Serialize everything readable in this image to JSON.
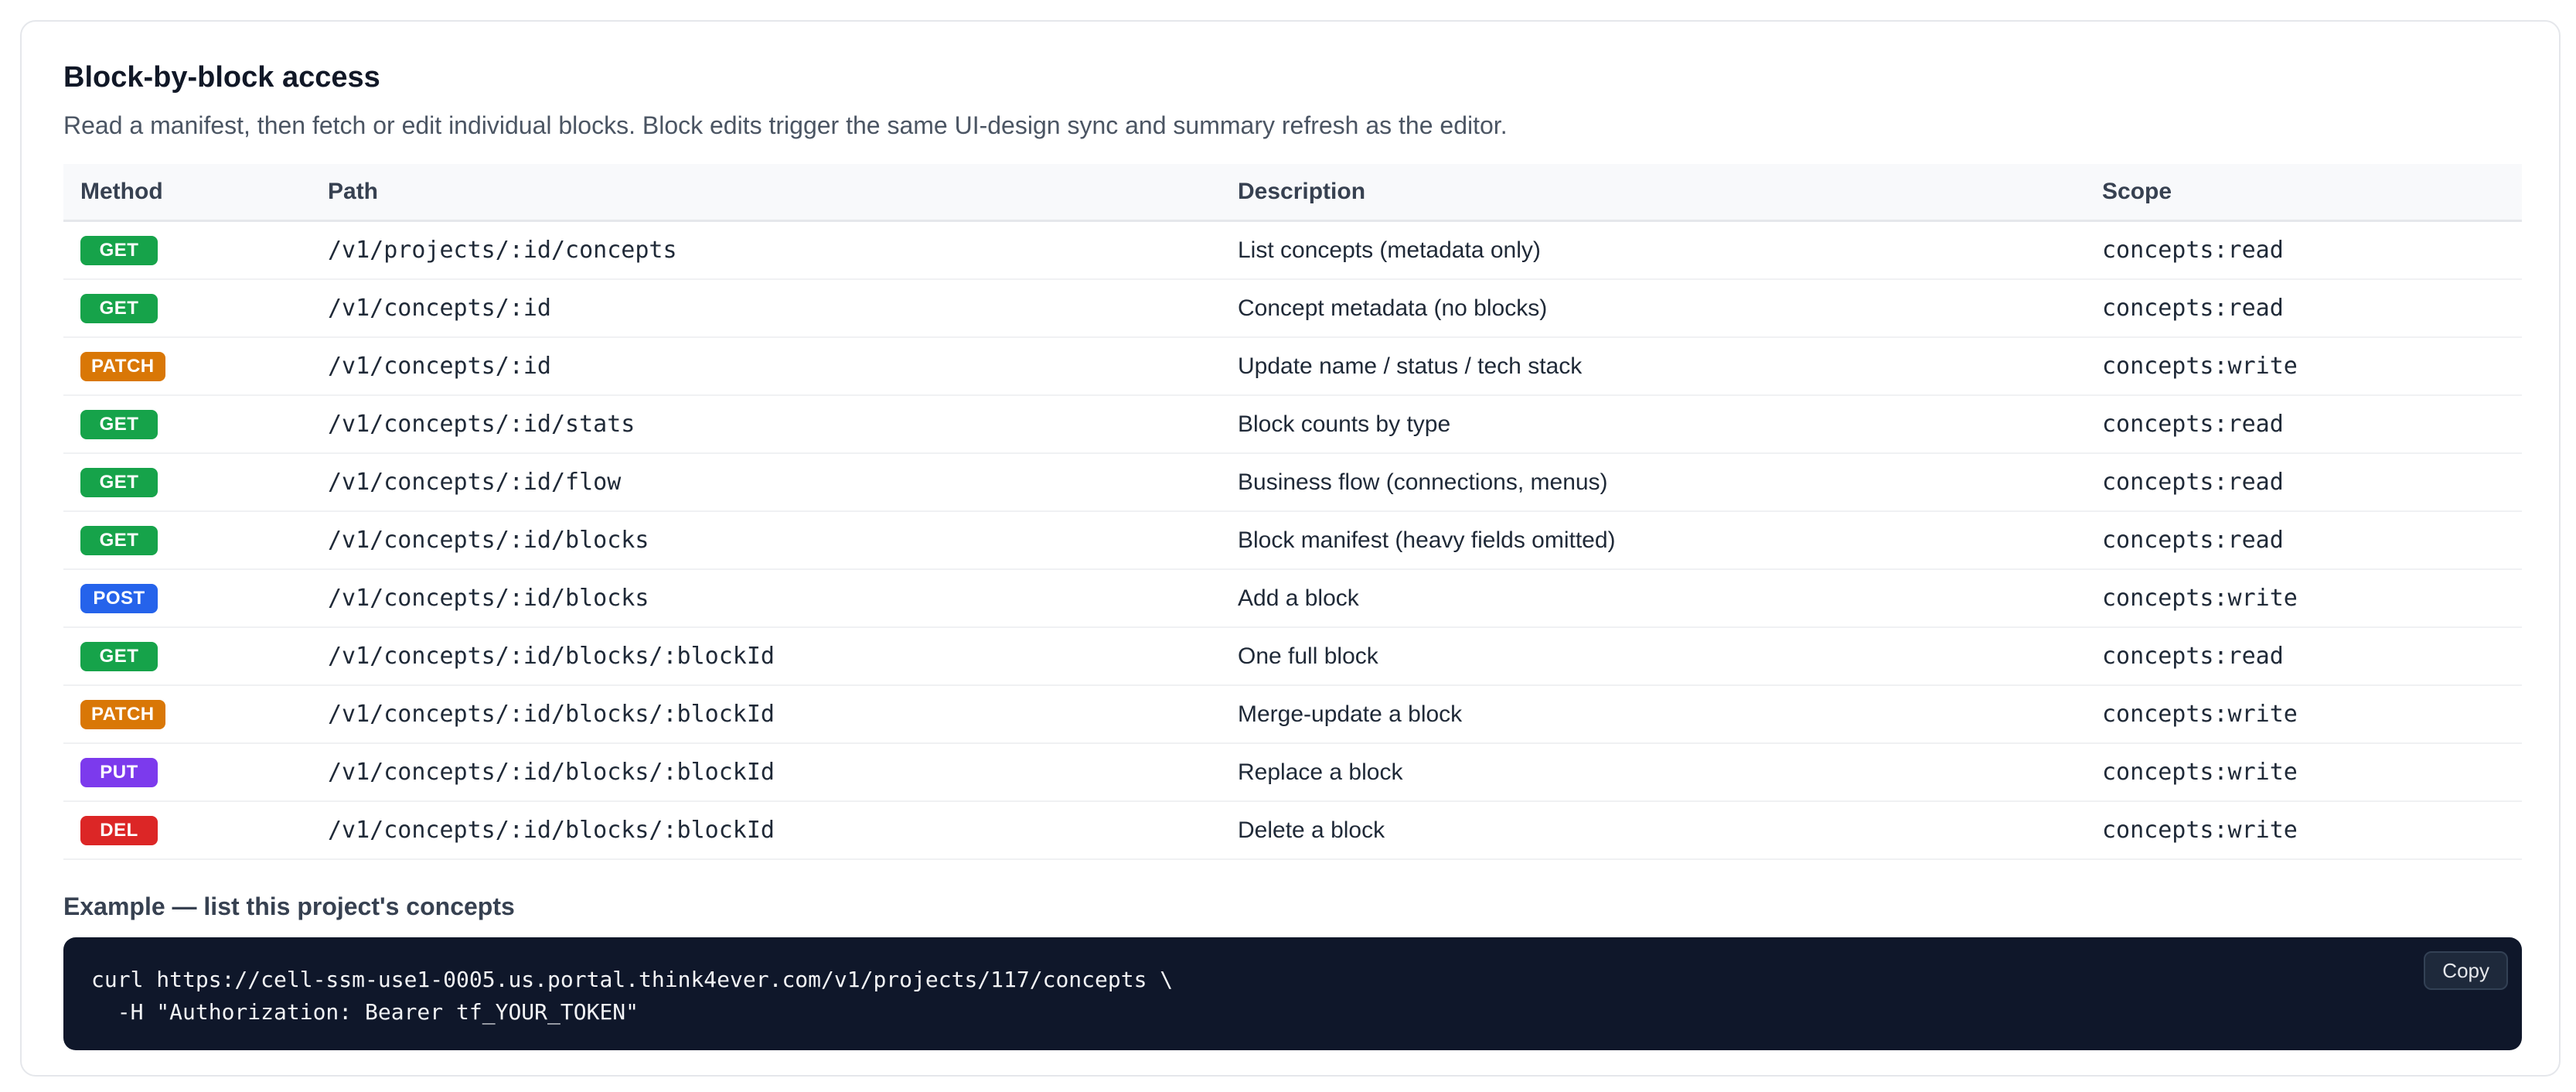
{
  "section": {
    "title": "Block-by-block access",
    "subtitle": "Read a manifest, then fetch or edit individual blocks. Block edits trigger the same UI-design sync and summary refresh as the editor."
  },
  "table": {
    "headers": {
      "method": "Method",
      "path": "Path",
      "description": "Description",
      "scope": "Scope"
    },
    "rows": [
      {
        "method": "GET",
        "path": "/v1/projects/:id/concepts",
        "description": "List concepts (metadata only)",
        "scope": "concepts:read"
      },
      {
        "method": "GET",
        "path": "/v1/concepts/:id",
        "description": "Concept metadata (no blocks)",
        "scope": "concepts:read"
      },
      {
        "method": "PATCH",
        "path": "/v1/concepts/:id",
        "description": "Update name / status / tech stack",
        "scope": "concepts:write"
      },
      {
        "method": "GET",
        "path": "/v1/concepts/:id/stats",
        "description": "Block counts by type",
        "scope": "concepts:read"
      },
      {
        "method": "GET",
        "path": "/v1/concepts/:id/flow",
        "description": "Business flow (connections, menus)",
        "scope": "concepts:read"
      },
      {
        "method": "GET",
        "path": "/v1/concepts/:id/blocks",
        "description": "Block manifest (heavy fields omitted)",
        "scope": "concepts:read"
      },
      {
        "method": "POST",
        "path": "/v1/concepts/:id/blocks",
        "description": "Add a block",
        "scope": "concepts:write"
      },
      {
        "method": "GET",
        "path": "/v1/concepts/:id/blocks/:blockId",
        "description": "One full block",
        "scope": "concepts:read"
      },
      {
        "method": "PATCH",
        "path": "/v1/concepts/:id/blocks/:blockId",
        "description": "Merge-update a block",
        "scope": "concepts:write"
      },
      {
        "method": "PUT",
        "path": "/v1/concepts/:id/blocks/:blockId",
        "description": "Replace a block",
        "scope": "concepts:write"
      },
      {
        "method": "DEL",
        "path": "/v1/concepts/:id/blocks/:blockId",
        "description": "Delete a block",
        "scope": "concepts:write"
      }
    ]
  },
  "method_colors": {
    "GET": "#16a34a",
    "PATCH": "#d97706",
    "POST": "#2563eb",
    "PUT": "#7c3aed",
    "DEL": "#dc2626"
  },
  "example": {
    "title": "Example — list this project's concepts",
    "code_lines": [
      "curl https://cell-ssm-use1-0005.us.portal.think4ever.com/v1/projects/117/concepts \\",
      "  -H \"Authorization: Bearer tf_YOUR_TOKEN\""
    ],
    "copy_label": "Copy"
  }
}
